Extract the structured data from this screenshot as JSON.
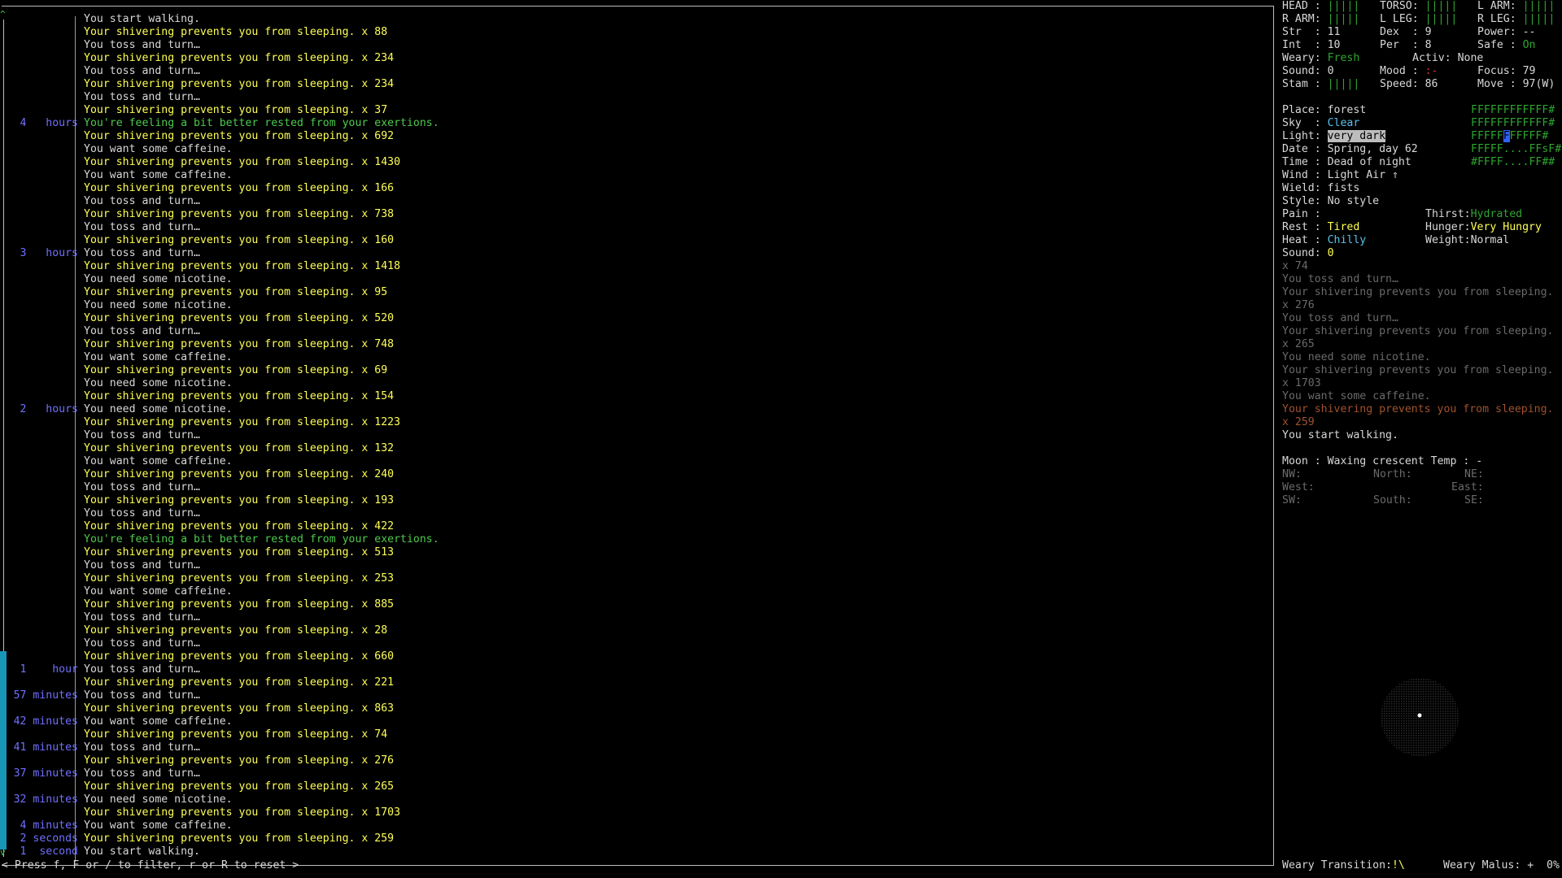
{
  "log": {
    "rows": [
      {
        "ts": "",
        "msg": "You start walking.",
        "color": "white",
        "count": ""
      },
      {
        "ts": "",
        "msg": "Your shivering prevents you from sleeping.",
        "color": "yellow",
        "count": "x 88"
      },
      {
        "ts": "",
        "msg": "You toss and turn…",
        "color": "white",
        "count": ""
      },
      {
        "ts": "",
        "msg": "Your shivering prevents you from sleeping.",
        "color": "yellow",
        "count": "x 234"
      },
      {
        "ts": "",
        "msg": "You toss and turn…",
        "color": "white",
        "count": ""
      },
      {
        "ts": "",
        "msg": "Your shivering prevents you from sleeping.",
        "color": "yellow",
        "count": "x 234"
      },
      {
        "ts": "",
        "msg": "You toss and turn…",
        "color": "white",
        "count": ""
      },
      {
        "ts": "",
        "msg": "Your shivering prevents you from sleeping.",
        "color": "yellow",
        "count": "x 37"
      },
      {
        "ts": "4   hours",
        "msg": "You're feeling a bit better rested from your exertions.",
        "color": "green",
        "count": ""
      },
      {
        "ts": "",
        "msg": "Your shivering prevents you from sleeping.",
        "color": "yellow",
        "count": "x 692"
      },
      {
        "ts": "",
        "msg": "You want some caffeine.",
        "color": "white",
        "count": ""
      },
      {
        "ts": "",
        "msg": "Your shivering prevents you from sleeping.",
        "color": "yellow",
        "count": "x 1430"
      },
      {
        "ts": "",
        "msg": "You want some caffeine.",
        "color": "white",
        "count": ""
      },
      {
        "ts": "",
        "msg": "Your shivering prevents you from sleeping.",
        "color": "yellow",
        "count": "x 166"
      },
      {
        "ts": "",
        "msg": "You toss and turn…",
        "color": "white",
        "count": ""
      },
      {
        "ts": "",
        "msg": "Your shivering prevents you from sleeping.",
        "color": "yellow",
        "count": "x 738"
      },
      {
        "ts": "",
        "msg": "You toss and turn…",
        "color": "white",
        "count": ""
      },
      {
        "ts": "",
        "msg": "Your shivering prevents you from sleeping.",
        "color": "yellow",
        "count": "x 160"
      },
      {
        "ts": "3   hours",
        "msg": "You toss and turn…",
        "color": "white",
        "count": ""
      },
      {
        "ts": "",
        "msg": "Your shivering prevents you from sleeping.",
        "color": "yellow",
        "count": "x 1418"
      },
      {
        "ts": "",
        "msg": "You need some nicotine.",
        "color": "white",
        "count": ""
      },
      {
        "ts": "",
        "msg": "Your shivering prevents you from sleeping.",
        "color": "yellow",
        "count": "x 95"
      },
      {
        "ts": "",
        "msg": "You need some nicotine.",
        "color": "white",
        "count": ""
      },
      {
        "ts": "",
        "msg": "Your shivering prevents you from sleeping.",
        "color": "yellow",
        "count": "x 520"
      },
      {
        "ts": "",
        "msg": "You toss and turn…",
        "color": "white",
        "count": ""
      },
      {
        "ts": "",
        "msg": "Your shivering prevents you from sleeping.",
        "color": "yellow",
        "count": "x 748"
      },
      {
        "ts": "",
        "msg": "You want some caffeine.",
        "color": "white",
        "count": ""
      },
      {
        "ts": "",
        "msg": "Your shivering prevents you from sleeping.",
        "color": "yellow",
        "count": "x 69"
      },
      {
        "ts": "",
        "msg": "You need some nicotine.",
        "color": "white",
        "count": ""
      },
      {
        "ts": "",
        "msg": "Your shivering prevents you from sleeping.",
        "color": "yellow",
        "count": "x 154"
      },
      {
        "ts": "2   hours",
        "msg": "You need some nicotine.",
        "color": "white",
        "count": ""
      },
      {
        "ts": "",
        "msg": "Your shivering prevents you from sleeping.",
        "color": "yellow",
        "count": "x 1223"
      },
      {
        "ts": "",
        "msg": "You toss and turn…",
        "color": "white",
        "count": ""
      },
      {
        "ts": "",
        "msg": "Your shivering prevents you from sleeping.",
        "color": "yellow",
        "count": "x 132"
      },
      {
        "ts": "",
        "msg": "You want some caffeine.",
        "color": "white",
        "count": ""
      },
      {
        "ts": "",
        "msg": "Your shivering prevents you from sleeping.",
        "color": "yellow",
        "count": "x 240"
      },
      {
        "ts": "",
        "msg": "You toss and turn…",
        "color": "white",
        "count": ""
      },
      {
        "ts": "",
        "msg": "Your shivering prevents you from sleeping.",
        "color": "yellow",
        "count": "x 193"
      },
      {
        "ts": "",
        "msg": "You toss and turn…",
        "color": "white",
        "count": ""
      },
      {
        "ts": "",
        "msg": "Your shivering prevents you from sleeping.",
        "color": "yellow",
        "count": "x 422"
      },
      {
        "ts": "",
        "msg": "You're feeling a bit better rested from your exertions.",
        "color": "green",
        "count": ""
      },
      {
        "ts": "",
        "msg": "Your shivering prevents you from sleeping.",
        "color": "yellow",
        "count": "x 513"
      },
      {
        "ts": "",
        "msg": "You toss and turn…",
        "color": "white",
        "count": ""
      },
      {
        "ts": "",
        "msg": "Your shivering prevents you from sleeping.",
        "color": "yellow",
        "count": "x 253"
      },
      {
        "ts": "",
        "msg": "You want some caffeine.",
        "color": "white",
        "count": ""
      },
      {
        "ts": "",
        "msg": "Your shivering prevents you from sleeping.",
        "color": "yellow",
        "count": "x 885"
      },
      {
        "ts": "",
        "msg": "You toss and turn…",
        "color": "white",
        "count": ""
      },
      {
        "ts": "",
        "msg": "Your shivering prevents you from sleeping.",
        "color": "yellow",
        "count": "x 28"
      },
      {
        "ts": "",
        "msg": "You toss and turn…",
        "color": "white",
        "count": ""
      },
      {
        "ts": "",
        "msg": "Your shivering prevents you from sleeping.",
        "color": "yellow",
        "count": "x 660"
      },
      {
        "ts": "1    hour",
        "msg": "You toss and turn…",
        "color": "white",
        "count": ""
      },
      {
        "ts": "",
        "msg": "Your shivering prevents you from sleeping.",
        "color": "yellow",
        "count": "x 221"
      },
      {
        "ts": "57 minutes",
        "msg": "You toss and turn…",
        "color": "white",
        "count": ""
      },
      {
        "ts": "",
        "msg": "Your shivering prevents you from sleeping.",
        "color": "yellow",
        "count": "x 863"
      },
      {
        "ts": "42 minutes",
        "msg": "You want some caffeine.",
        "color": "white",
        "count": ""
      },
      {
        "ts": "",
        "msg": "Your shivering prevents you from sleeping.",
        "color": "yellow",
        "count": "x 74"
      },
      {
        "ts": "41 minutes",
        "msg": "You toss and turn…",
        "color": "white",
        "count": ""
      },
      {
        "ts": "",
        "msg": "Your shivering prevents you from sleeping.",
        "color": "yellow",
        "count": "x 276"
      },
      {
        "ts": "37 minutes",
        "msg": "You toss and turn…",
        "color": "white",
        "count": ""
      },
      {
        "ts": "",
        "msg": "Your shivering prevents you from sleeping.",
        "color": "yellow",
        "count": "x 265"
      },
      {
        "ts": "32 minutes",
        "msg": "You need some nicotine.",
        "color": "white",
        "count": ""
      },
      {
        "ts": "",
        "msg": "Your shivering prevents you from sleeping.",
        "color": "yellow",
        "count": "x 1703"
      },
      {
        "ts": "4 minutes",
        "msg": "You want some caffeine.",
        "color": "white",
        "count": ""
      },
      {
        "ts": "2 seconds",
        "msg": "Your shivering prevents you from sleeping.",
        "color": "yellow",
        "count": "x 259"
      },
      {
        "ts": "1  second",
        "msg": "You start walking.",
        "color": "white",
        "count": ""
      }
    ],
    "footer_hint": "< Press f, F or / to filter, r or R to reset >",
    "arrow_up": "^",
    "arrow_down": "v"
  },
  "sidebar": {
    "limbs": {
      "head": "HEAD :",
      "head_bar": "|||||",
      "torso": "TORSO:",
      "torso_bar": "|||||",
      "larm": "L ARM:",
      "larm_bar": "|||||",
      "rarm": "R ARM:",
      "rarm_bar": "|||||",
      "lleg": "L LEG:",
      "lleg_bar": "|||||",
      "rleg": "R LEG:",
      "rleg_bar": "|||||"
    },
    "stats": {
      "str_label": "Str  :",
      "str": "11",
      "dex_label": "Dex  :",
      "dex": "9",
      "power_label": "Power:",
      "power": "--",
      "int_label": "Int  :",
      "int": "10",
      "per_label": "Per  :",
      "per": "8",
      "safe_label": "Safe :",
      "safe": "On",
      "weary_label": "Weary:",
      "weary": "Fresh",
      "activ_label": "Activ:",
      "activ": "None",
      "sound_label": "Sound:",
      "sound": "0",
      "mood_label": "Mood :",
      "mood": ":-",
      "focus_label": "Focus:",
      "focus": "79",
      "stam_label": "Stam :",
      "stam_bar": "|||||",
      "speed_label": "Speed:",
      "speed": "86",
      "move_label": "Move :",
      "move": "97(W)"
    },
    "env": {
      "place_label": "Place:",
      "place": "forest",
      "sky_label": "Sky  :",
      "sky": "Clear",
      "light_label": "Light:",
      "light": "very dark",
      "date_label": "Date :",
      "date": "Spring, day 62",
      "time_label": "Time :",
      "time": "Dead of night",
      "wind_label": "Wind :",
      "wind": "Light Air ⇑",
      "wield_label": "Wield:",
      "wield": "fists",
      "style_label": "Style:",
      "style": "No style",
      "pain_label": "Pain :",
      "pain": "",
      "thirst_label": "Thirst:",
      "thirst": "Hydrated",
      "rest_label": "Rest :",
      "rest": "Tired",
      "hunger_label": "Hunger:",
      "hunger": "Very Hungry",
      "heat_label": "Heat :",
      "heat": "Chilly",
      "weight_label": "Weight:",
      "weight": "Normal",
      "sound2_label": "Sound:",
      "sound2": "0"
    },
    "minimap": [
      "FFFFFFFFFFFF#",
      "FFFFFFFFFFFF#",
      "FFFFF",
      "FFFFF....FFsF#",
      "#FFFF....FF##"
    ],
    "minimap_cursor": "F",
    "minimap_row2_tail": "FFFFF#",
    "messages": [
      {
        "text": "x 74",
        "color": "gray"
      },
      {
        "text": "You toss and turn…",
        "color": "gray"
      },
      {
        "text": "Your shivering prevents you from sleeping.",
        "color": "gray"
      },
      {
        "text": "x 276",
        "color": "gray"
      },
      {
        "text": "You toss and turn…",
        "color": "gray"
      },
      {
        "text": "Your shivering prevents you from sleeping.",
        "color": "gray"
      },
      {
        "text": "x 265",
        "color": "gray"
      },
      {
        "text": "You need some nicotine.",
        "color": "gray"
      },
      {
        "text": "Your shivering prevents you from sleeping.",
        "color": "gray"
      },
      {
        "text": "x 1703",
        "color": "gray"
      },
      {
        "text": "You want some caffeine.",
        "color": "gray"
      },
      {
        "text": "Your shivering prevents you from sleeping.",
        "color": "brown"
      },
      {
        "text": "x 259",
        "color": "brown"
      },
      {
        "text": "You start walking.",
        "color": "white"
      }
    ],
    "moon": {
      "label": "Moon :",
      "value": "Waxing crescent",
      "temp_label": "Temp :",
      "temp": "-",
      "nw": "NW:",
      "north": "North:",
      "ne": "NE:",
      "west": "West:",
      "east": "East:",
      "sw": "SW:",
      "south": "South:",
      "se": "SE:"
    },
    "weary_transition_label": "Weary Transition:",
    "weary_transition": "!\\",
    "weary_malus_label": "Weary Malus:",
    "weary_malus": "+  0%"
  },
  "colors": {
    "white": "#d8d8d8",
    "yellow": "#ffff55",
    "green": "#4ec94e",
    "blue": "#7070ff",
    "cyan": "#5bc0eb",
    "gray": "#6a6a6a",
    "brown": "#a0522d",
    "scrollbar": "#1796b8"
  }
}
